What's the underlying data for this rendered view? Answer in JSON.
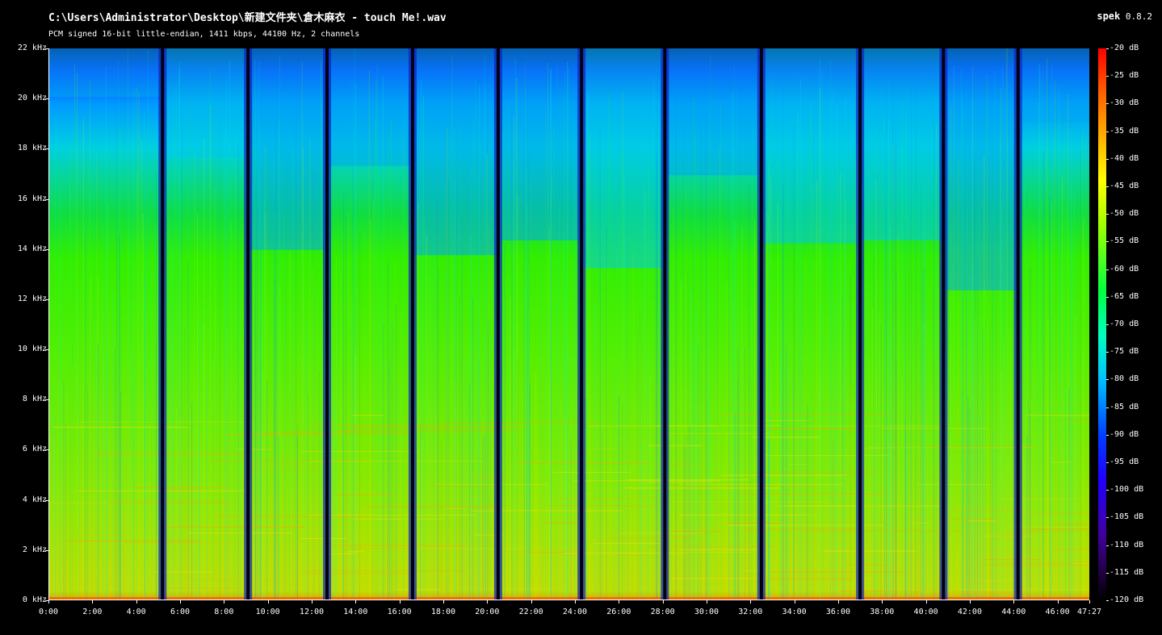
{
  "header": {
    "file_path": "C:\\Users\\Administrator\\Desktop\\新建文件夹\\倉木麻衣 - touch Me!.wav",
    "audio_info": "PCM signed 16-bit little-endian, 1411 kbps, 44100 Hz, 2 channels",
    "app_name": "spek",
    "app_version": "0.8.2"
  },
  "frequency_axis": {
    "labels": [
      "22 kHz",
      "20 kHz",
      "18 kHz",
      "16 kHz",
      "14 kHz",
      "12 kHz",
      "10 kHz",
      "8 kHz",
      "6 kHz",
      "4 kHz",
      "2 kHz",
      "0 kHz"
    ]
  },
  "time_axis": {
    "labels": [
      "0:00",
      "2:00",
      "4:00",
      "6:00",
      "8:00",
      "10:00",
      "12:00",
      "14:00",
      "16:00",
      "18:00",
      "20:00",
      "22:00",
      "24:00",
      "26:00",
      "28:00",
      "30:00",
      "32:00",
      "34:00",
      "36:00",
      "38:00",
      "40:00",
      "42:00",
      "44:00",
      "46:00",
      "47:27"
    ]
  },
  "colorbar": {
    "labels": [
      "-20 dB",
      "-25 dB",
      "-30 dB",
      "-35 dB",
      "-40 dB",
      "-45 dB",
      "-50 dB",
      "-55 dB",
      "-60 dB",
      "-65 dB",
      "-70 dB",
      "-75 dB",
      "-80 dB",
      "-85 dB",
      "-90 dB",
      "-95 dB",
      "-100 dB",
      "-105 dB",
      "-110 dB",
      "-115 dB",
      "-120 dB"
    ]
  },
  "track_gaps_minutes": [
    5.2,
    9.1,
    12.7,
    16.6,
    20.5,
    24.3,
    28.1,
    32.5,
    37.0,
    40.8,
    44.2
  ]
}
